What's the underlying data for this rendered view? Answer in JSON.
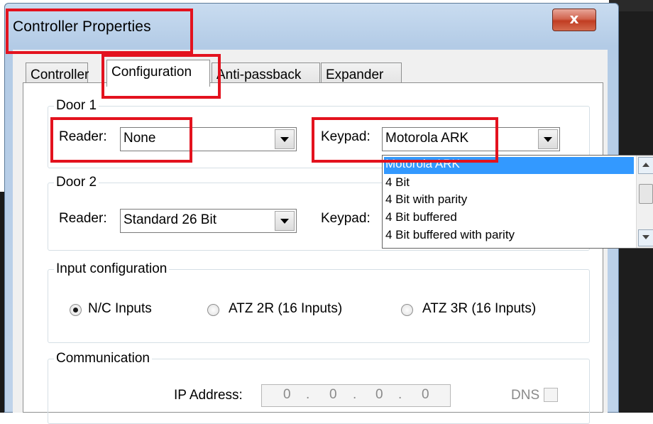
{
  "window": {
    "title": "Controller Properties",
    "close_label": "x"
  },
  "tabs": [
    {
      "label": "Controller",
      "active": false
    },
    {
      "label": "Configuration",
      "active": true
    },
    {
      "label": "Anti-passback",
      "active": false
    },
    {
      "label": "Expander",
      "active": false
    }
  ],
  "door1": {
    "group_label": "Door 1",
    "reader_label": "Reader:",
    "reader_value": "None",
    "keypad_label": "Keypad:",
    "keypad_value": "Motorola ARK"
  },
  "door2": {
    "group_label": "Door 2",
    "reader_label": "Reader:",
    "reader_value": "Standard 26 Bit",
    "keypad_label": "Keypad:"
  },
  "keypad_dropdown": {
    "options": [
      "Motorola ARK",
      "4 Bit",
      "4 Bit with parity",
      "4 Bit buffered",
      "4 Bit buffered with parity"
    ],
    "selected": "Motorola ARK"
  },
  "input_config": {
    "group_label": "Input configuration",
    "options": [
      {
        "label": "N/C Inputs",
        "checked": true
      },
      {
        "label": "ATZ 2R (16 Inputs)",
        "checked": false
      },
      {
        "label": "ATZ 3R (16 Inputs)",
        "checked": false
      }
    ]
  },
  "communication": {
    "group_label": "Communication",
    "ip_label": "IP Address:",
    "ip_octets": [
      "0",
      "0",
      "0",
      "0"
    ],
    "ip_separator": ".",
    "dns_label": "DNS",
    "dns_checked": false
  },
  "colors": {
    "highlight": "#e3121e",
    "selection": "#3399ff",
    "close_button": "#c13d22"
  }
}
